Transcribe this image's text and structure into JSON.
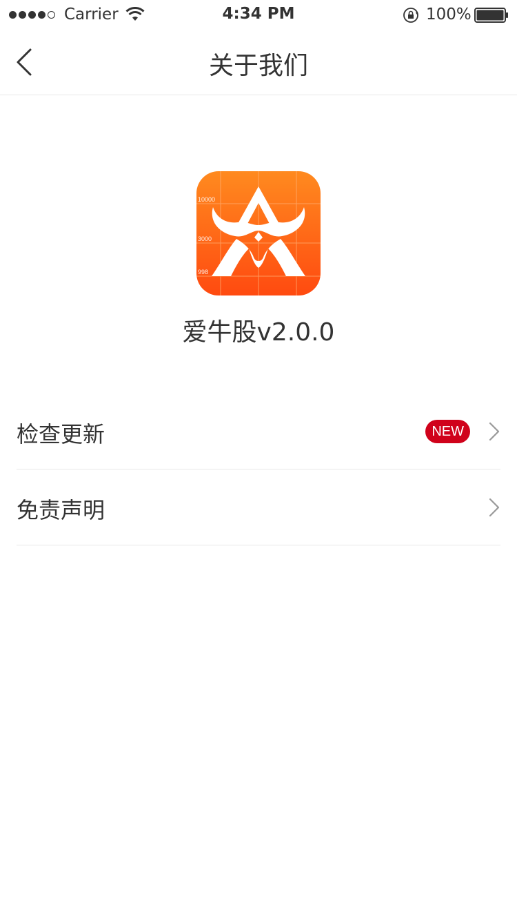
{
  "status_bar": {
    "carrier": "Carrier",
    "time": "4:34 PM",
    "battery": "100%"
  },
  "nav": {
    "title": "关于我们"
  },
  "app": {
    "name_version": "爱牛股v2.0.0",
    "logo_labels": [
      "10000",
      "3000",
      "998"
    ]
  },
  "list": {
    "items": [
      {
        "label": "检查更新",
        "badge": "NEW"
      },
      {
        "label": "免责声明"
      }
    ]
  },
  "colors": {
    "badge_red": "#d0021b",
    "logo_orange_top": "#ff8a1f",
    "logo_orange_bottom": "#ff4a10",
    "text": "#333333",
    "divider": "#e8e8e8"
  }
}
